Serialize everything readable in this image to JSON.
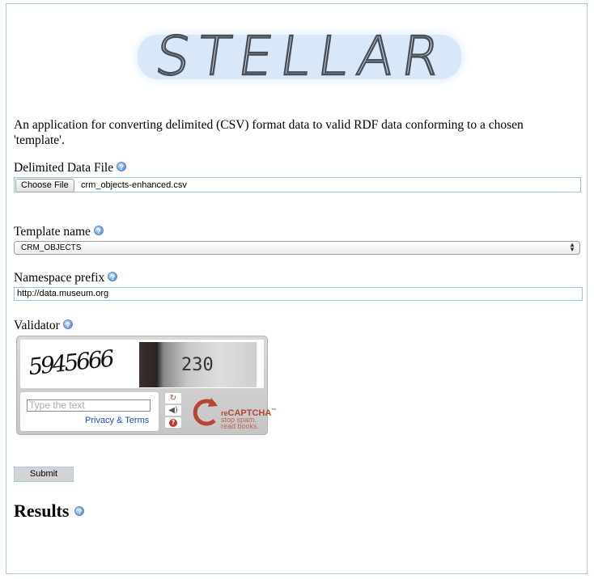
{
  "app": {
    "logo_text": "STELLAR"
  },
  "intro": "An application for converting delimited (CSV) format data to valid RDF data conforming to a chosen 'template'.",
  "form": {
    "data_file": {
      "label": "Delimited Data File",
      "button": "Choose File",
      "file_name": "crm_objects-enhanced.csv",
      "help_icon": "help-icon"
    },
    "template": {
      "label": "Template name",
      "selected": "CRM_OBJECTS",
      "help_icon": "help-icon"
    },
    "namespace": {
      "label": "Namespace prefix",
      "value": "http://data.museum.org",
      "help_icon": "help-icon"
    },
    "validator": {
      "label": "Validator",
      "help_icon": "help-icon",
      "captcha": {
        "word1": "5945666",
        "word2": "230",
        "placeholder": "Type the text",
        "privacy_link": "Privacy & Terms",
        "tools": [
          "refresh-icon",
          "audio-icon",
          "help-icon"
        ],
        "brand_re": "re",
        "brand": "CAPTCHA",
        "tagline_1": "stop spam.",
        "tagline_2": "read books."
      }
    },
    "submit": "Submit"
  },
  "results": {
    "heading": "Results",
    "help_icon": "help-icon"
  },
  "colors": {
    "frame_border": "#a9cbe0",
    "link": "#1a4dbf",
    "recaptcha_red": "#b84534"
  }
}
